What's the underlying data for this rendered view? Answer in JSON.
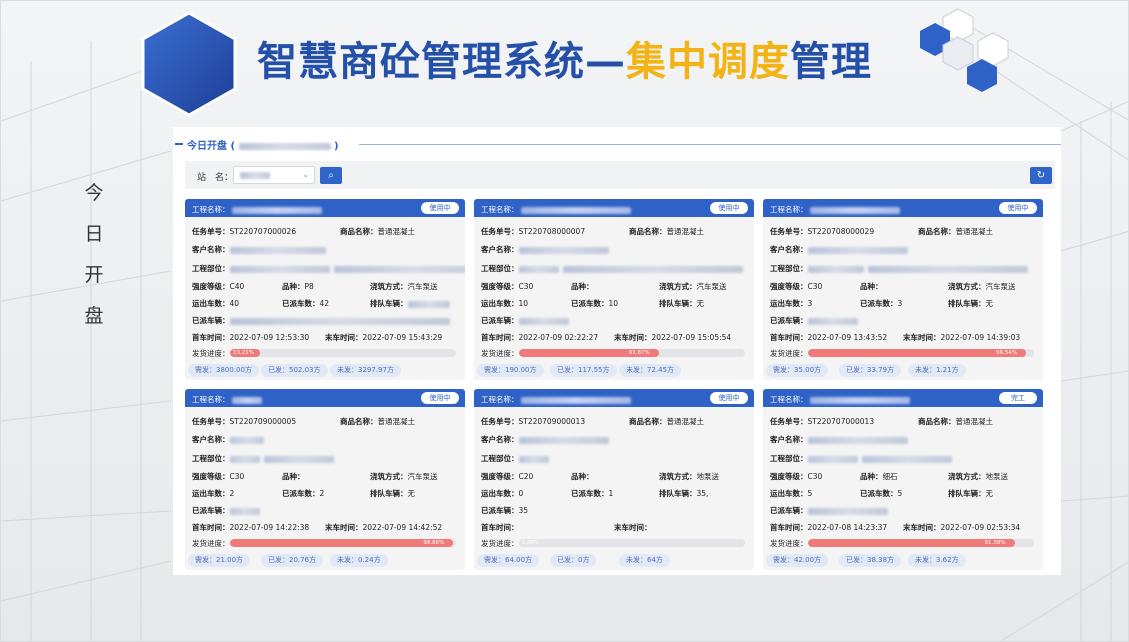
{
  "header": {
    "title_part1": "智慧商砼管理系统—",
    "title_highlight": "集中调度",
    "title_part2": "管理"
  },
  "side_label": [
    "今",
    "日",
    "开",
    "盘"
  ],
  "panel": {
    "title_prefix": "今日开盘 (",
    "title_suffix": ")"
  },
  "toolbar": {
    "station_label": "站　名：",
    "select_chevron": "⌄",
    "search_glyph": "⌕",
    "refresh_glyph": "↻"
  },
  "labels": {
    "project_name": "工程名称：",
    "task_no": "任务单号：",
    "product_name": "商品名称：",
    "customer": "客户名称：",
    "part": "工程部位：",
    "grade": "强度等级：",
    "variety": "品种：",
    "pour": "浇筑方式：",
    "trips": "运出车数：",
    "dispatched": "已派车数：",
    "queue": "排队车辆：",
    "sent_vehicles": "已派车辆：",
    "first_time": "首车时间：",
    "last_time": "末车时间：",
    "progress": "发货进度："
  },
  "cards": [
    {
      "status": "使用中",
      "task_no": "ST220707000026",
      "product": "普通混凝土",
      "grade": "C40",
      "variety": "P8",
      "pour": "汽车泵送",
      "trips": "40",
      "dispatched": "42",
      "queue": "",
      "first_time": "2022-07-09 12:53:30",
      "last_time": "2022-07-09 15:43:29",
      "progress": 0.1321,
      "progress_text": "13.21%",
      "need": "需发：3800.00方",
      "sent": "已发：502.03方",
      "unsent": "未发：3297.97方"
    },
    {
      "status": "使用中",
      "task_no": "ST220708000007",
      "product": "普通混凝土",
      "grade": "C30",
      "variety": "",
      "pour": "汽车泵送",
      "trips": "10",
      "dispatched": "10",
      "queue": "无",
      "first_time": "2022-07-09 02:22:27",
      "last_time": "2022-07-09 15:05:54",
      "progress": 0.6187,
      "progress_text": "61.87%",
      "need": "需发：190.00方",
      "sent": "已发：117.55方",
      "unsent": "未发：72.45方"
    },
    {
      "status": "使用中",
      "task_no": "ST220708000029",
      "product": "普通混凝土",
      "grade": "C30",
      "variety": "",
      "pour": "汽车泵送",
      "trips": "3",
      "dispatched": "3",
      "queue": "无",
      "first_time": "2022-07-09 13:43:52",
      "last_time": "2022-07-09 14:39:03",
      "progress": 0.9654,
      "progress_text": "96.54%",
      "need": "需发：35.00方",
      "sent": "已发：33.79方",
      "unsent": "未发：1.21方"
    },
    {
      "status": "使用中",
      "task_no": "ST220709000005",
      "product": "普通混凝土",
      "grade": "C30",
      "variety": "",
      "pour": "汽车泵送",
      "trips": "2",
      "dispatched": "2",
      "queue": "无",
      "first_time": "2022-07-09 14:22:38",
      "last_time": "2022-07-09 14:42:52",
      "progress": 0.9886,
      "progress_text": "98.86%",
      "need": "需发：21.00方",
      "sent": "已发：20.76方",
      "unsent": "未发：0.24方"
    },
    {
      "status": "使用中",
      "task_no": "ST220709000013",
      "product": "普通混凝土",
      "grade": "C20",
      "variety": "",
      "pour": "地泵送",
      "trips": "0",
      "dispatched": "1",
      "queue": "35,",
      "sent_text": "35",
      "first_time": "",
      "last_time": "",
      "progress": 0.0,
      "progress_text": "0.00%",
      "need": "需发：64.00方",
      "sent": "已发：0方",
      "unsent": "未发：64方"
    },
    {
      "status": "完工",
      "task_no": "ST220707000013",
      "product": "普通混凝土",
      "grade": "C30",
      "variety": "细石",
      "pour": "地泵送",
      "trips": "5",
      "dispatched": "5",
      "queue": "无",
      "first_time": "2022-07-08 14:23:37",
      "last_time": "2022-07-09 02:53:34",
      "progress": 0.9138,
      "progress_text": "91.38%",
      "need": "需发：42.00方",
      "sent": "已发：38.38方",
      "unsent": "未发：3.62方"
    }
  ],
  "colors": {
    "brand_blue": "#2550a8",
    "highlight_yellow": "#f2b316",
    "card_header": "#2f62c6",
    "progress_fill": "#f07a7a"
  }
}
